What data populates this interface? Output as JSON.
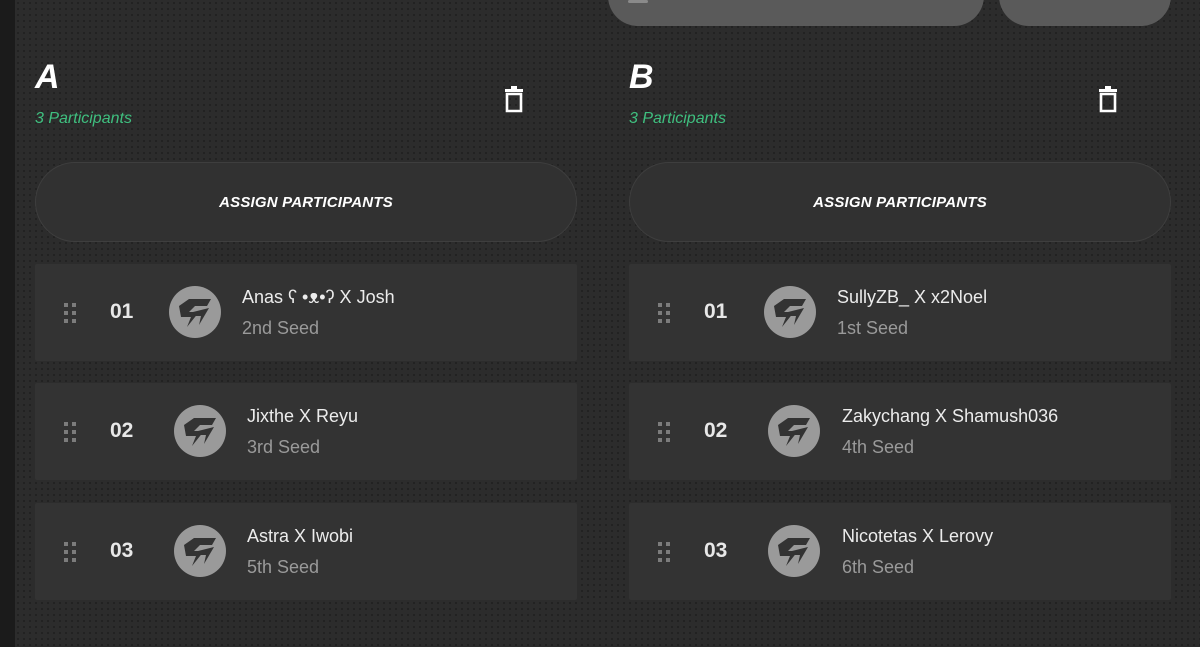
{
  "groups": [
    {
      "title": "A",
      "participant_count": "3 Participants",
      "assign_label": "ASSIGN PARTICIPANTS",
      "participants": [
        {
          "number": "01",
          "name": "Anas ʕ •ᴥ•ʔ X Josh",
          "seed": "2nd Seed"
        },
        {
          "number": "02",
          "name": "Jixthe X Reyu",
          "seed": "3rd Seed"
        },
        {
          "number": "03",
          "name": "Astra X Iwobi",
          "seed": "5th Seed"
        }
      ]
    },
    {
      "title": "B",
      "participant_count": "3 Participants",
      "assign_label": "ASSIGN PARTICIPANTS",
      "participants": [
        {
          "number": "01",
          "name": "SullyZB_ X x2Noel",
          "seed": "1st Seed"
        },
        {
          "number": "02",
          "name": "Zakychang X Shamush036",
          "seed": "4th Seed"
        },
        {
          "number": "03",
          "name": "Nicotetas X Lerovy",
          "seed": "6th Seed"
        }
      ]
    }
  ],
  "icons": {
    "delete": "trash-icon",
    "drag": "drag-handle-icon",
    "avatar": "team-logo-icon"
  },
  "colors": {
    "background": "#2c2c2c",
    "card": "#333333",
    "accent_green": "#3fbf7f",
    "text_primary": "#ececec",
    "text_secondary": "#9a9a9a"
  }
}
